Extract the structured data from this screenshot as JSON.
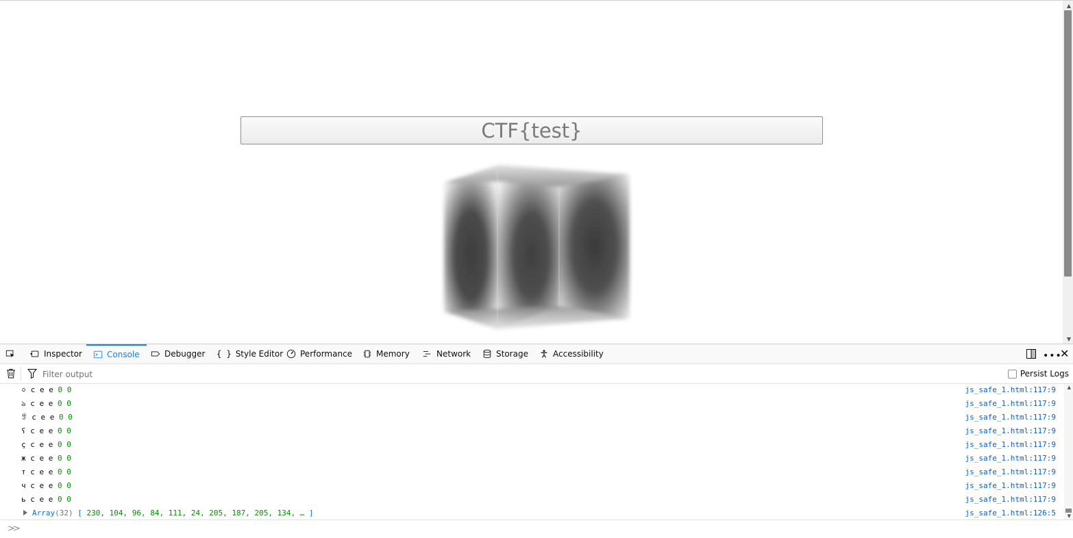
{
  "page": {
    "input_value": "CTF{test}"
  },
  "devtools": {
    "tabs": [
      {
        "label": "Inspector",
        "icon": "inspector-icon"
      },
      {
        "label": "Console",
        "icon": "console-icon",
        "selected": true
      },
      {
        "label": "Debugger",
        "icon": "debugger-icon"
      },
      {
        "label": "Style Editor",
        "icon": "style-editor-icon"
      },
      {
        "label": "Performance",
        "icon": "performance-icon"
      },
      {
        "label": "Memory",
        "icon": "memory-icon"
      },
      {
        "label": "Network",
        "icon": "network-icon"
      },
      {
        "label": "Storage",
        "icon": "storage-icon"
      },
      {
        "label": "Accessibility",
        "icon": "accessibility-icon"
      }
    ],
    "filter_placeholder": "Filter output",
    "persist_logs_label": "Persist Logs",
    "accent_color": "#0a84ff",
    "log_rows": [
      {
        "char": "০",
        "rest": "c e e",
        "nums": "0 0",
        "source": "js_safe_1.html:117:9"
      },
      {
        "char": "ঌ",
        "rest": "c e e",
        "nums": "0 0",
        "source": "js_safe_1.html:117:9"
      },
      {
        "char": "ꌣ",
        "rest": "c e e",
        "nums": "0 0",
        "source": "js_safe_1.html:117:9"
      },
      {
        "char": "ʕ",
        "rest": "c e e",
        "nums": "0 0",
        "source": "js_safe_1.html:117:9"
      },
      {
        "char": "ç",
        "rest": "c e e",
        "nums": "0 0",
        "source": "js_safe_1.html:117:9"
      },
      {
        "char": "ж",
        "rest": "c e e",
        "nums": "0 0",
        "source": "js_safe_1.html:117:9"
      },
      {
        "char": "т",
        "rest": "c e e",
        "nums": "0 0",
        "source": "js_safe_1.html:117:9"
      },
      {
        "char": "ч",
        "rest": "c e e",
        "nums": "0 0",
        "source": "js_safe_1.html:117:9"
      },
      {
        "char": "ь",
        "rest": "c e e",
        "nums": "0 0",
        "source": "js_safe_1.html:117:9"
      }
    ],
    "array_row": {
      "name": "Array",
      "length": "(32)",
      "open": "[",
      "values": "230, 104, 96, 84, 111, 24, 205, 187, 205, 134, …",
      "close": "]",
      "source": "js_safe_1.html:126:5"
    }
  }
}
